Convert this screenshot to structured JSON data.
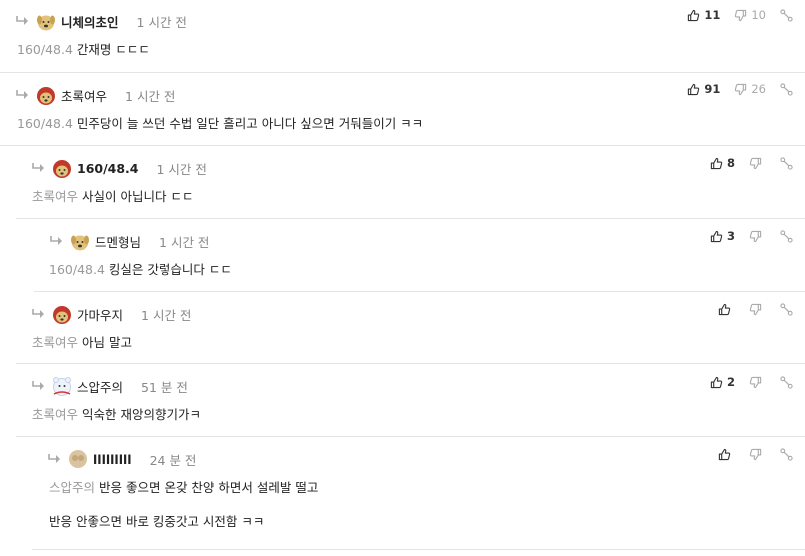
{
  "comments": [
    {
      "nick": "니체의초인",
      "time": "1 시간 전",
      "mention": "160/48.4",
      "text": "간재명 ㄷㄷㄷ",
      "up": "11",
      "down": "10"
    },
    {
      "nick": "초록여우",
      "time": "1 시간 전",
      "mention": "160/48.4",
      "text": "민주당이 늘 쓰던 수법 일단 흘리고 아니다 싶으면 거둬들이기 ㅋㅋ",
      "up": "91",
      "down": "26"
    },
    {
      "nick": "160/48.4",
      "time": "1 시간 전",
      "mention": "초록여우",
      "text": "사실이 아닙니다 ㄷㄷ",
      "up": "8",
      "down": ""
    },
    {
      "nick": "드멘형님",
      "time": "1 시간 전",
      "mention": "160/48.4",
      "text": "킹실은 갓렇습니다 ㄷㄷ",
      "up": "3",
      "down": ""
    },
    {
      "nick": "가마우지",
      "time": "1 시간 전",
      "mention": "초록여우",
      "text": "아님 말고",
      "up": "",
      "down": ""
    },
    {
      "nick": "스압주의",
      "time": "51 분 전",
      "mention": "초록여우",
      "text": "익숙한 재앙의향기가ㅋ",
      "up": "2",
      "down": ""
    },
    {
      "nick": "lllllllll",
      "time": "24 분 전",
      "mention": "스압주의",
      "text": "반응 좋으면 온갖 찬양 하면서 설레발 떨고",
      "text2": "반응 안좋으면 바로 킹중갓고 시전함 ㅋㅋ",
      "up": "",
      "down": ""
    }
  ],
  "icons": {
    "reply": "reply-arrow-icon",
    "up": "thumbs-up-icon",
    "down": "thumbs-down-icon",
    "share": "share-icon"
  },
  "colors": {
    "fox_avatar": "#c0392b",
    "dog_avatar": "#d8b25a",
    "border": "#e4e4e4"
  }
}
